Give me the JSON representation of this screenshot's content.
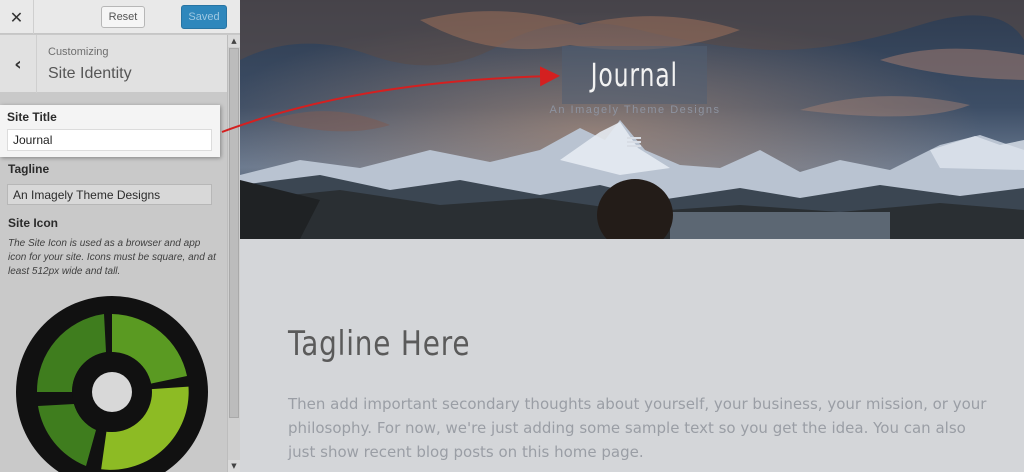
{
  "sidebar": {
    "close_icon": "close-icon",
    "reset_label": "Reset",
    "saved_label": "Saved",
    "back_icon": "chevron-left-icon",
    "customizing_label": "Customizing",
    "section_title": "Site Identity",
    "site_title": {
      "label": "Site Title",
      "value": "Journal"
    },
    "tagline": {
      "label": "Tagline",
      "value": "An Imagely Theme Designs"
    },
    "site_icon": {
      "label": "Site Icon",
      "description": "The Site Icon is used as a browser and app icon for your site. Icons must be square, and at least 512px wide and tall."
    },
    "colors": {
      "saved_button": "#2f87bc",
      "icon_ring": "#111111",
      "icon_green_dark": "#3f7d1e",
      "icon_green_light": "#8dbb24"
    }
  },
  "preview": {
    "site_name": "Journal",
    "site_description": "An Imagely Theme Designs",
    "menu_icon": "hamburger-menu-icon",
    "tagline_heading": "Tagline Here",
    "body_text": "Then add important secondary thoughts about yourself, your business, your mission, or your philosophy. For now, we're just adding some sample text so you get the idea. You can also just show recent blog posts on this home page.",
    "annotation_arrow_color": "#d42020"
  }
}
